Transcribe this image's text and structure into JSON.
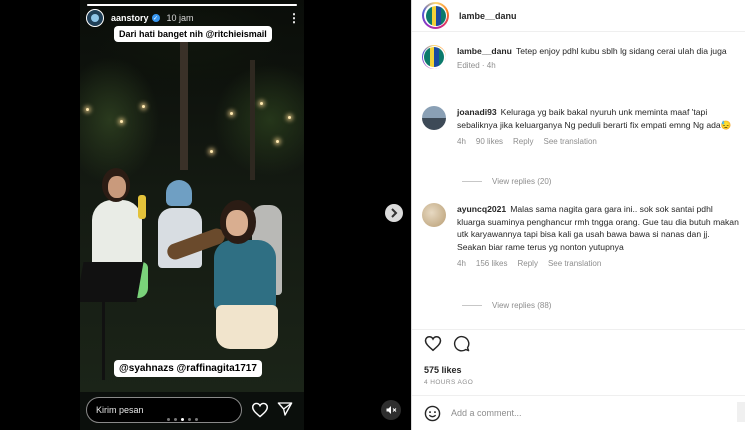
{
  "story": {
    "username": "aanstory",
    "time": "10 jam",
    "caption_top": "Dari hati banget nih @ritchieismail",
    "caption_bottom": "@syahnazs @raffinagita1717",
    "reply_placeholder": "Kirim pesan",
    "progress": 1.0,
    "dots": 5,
    "active_dot": 2
  },
  "post": {
    "username": "lambe__danu",
    "caption_user": "lambe__danu",
    "caption_text": "Tetep enjoy pdhl kubu sblh lg sidang cerai ulah dia juga",
    "caption_meta": "Edited · 4h"
  },
  "comments": [
    {
      "user": "joanadi93",
      "text": "Keluraga yg baik bakal nyuruh unk meminta maaf 'tapi sebaliknya jika keluarganya Ng peduli berarti fix empati emng Ng ada😓",
      "time": "4h",
      "likes": "90 likes",
      "reply": "Reply",
      "translate": "See translation",
      "view_replies": "View replies (20)"
    },
    {
      "user": "ayuncq2021",
      "text": "Malas sama nagita gara gara ini.. sok sok santai pdhl kluarga suaminya penghancur rmh tngga orang. Gue tau dia butuh makan utk karyawannya tapi bisa kali ga usah bawa bawa si nanas dan jj. Seakan biar rame terus yg nonton yutupnya",
      "time": "4h",
      "likes": "156 likes",
      "reply": "Reply",
      "translate": "See translation",
      "view_replies": "View replies (88)"
    }
  ],
  "actions": {
    "likes": "575 likes",
    "ago": "4 HOURS AGO"
  },
  "add_comment": {
    "placeholder": "Add a comment..."
  },
  "icons": {
    "heart": "heart-icon",
    "comment": "comment-icon",
    "send": "send-icon",
    "emoji": "emoji-icon",
    "mute": "mute-icon",
    "next": "chevron-right-icon",
    "more": "more-icon"
  }
}
